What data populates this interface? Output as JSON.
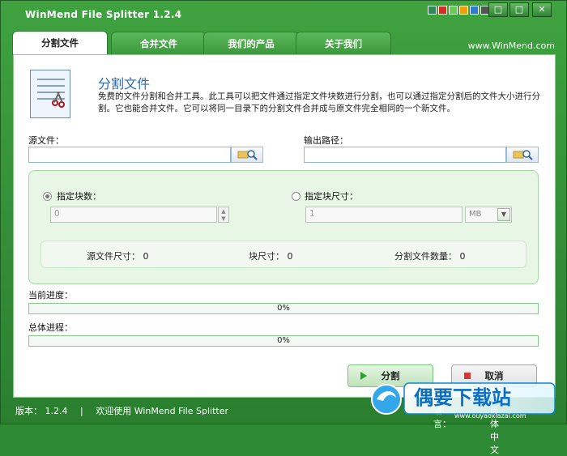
{
  "window": {
    "title": "WinMend File Splitter 1.2.4",
    "colors": {
      "green": "#2f8a35",
      "active_tab": "#ffffff",
      "accent_blue": "#2a6ab4"
    },
    "controls": {
      "minimize": "□",
      "restore": "□",
      "close": "✕"
    }
  },
  "tabs": {
    "split_file": "分割文件",
    "merge_file": "合并文件",
    "our_products": "我们的产品",
    "about_us": "关于我们"
  },
  "website": "www.WinMend.com",
  "header": {
    "title": "分割文件",
    "description": "免费的文件分割和合并工具。此工具可以把文件通过指定文件块数进行分割，也可以通过指定分割后的文件大小进行分割。它也能合并文件。它可以将同一目录下的分割文件合并成与原文件完全相同的一个新文件。"
  },
  "source_file": {
    "label": "源文件：",
    "value": ""
  },
  "output_path": {
    "label": "输出路径：",
    "value": ""
  },
  "split_options": {
    "count_label": "指定块数：",
    "count_value": "0",
    "size_label": "指定块尺寸：",
    "size_value": "1",
    "size_unit": "MB"
  },
  "info": {
    "source_size": "源文件尺寸： 0",
    "block_size": "块尺寸： 0",
    "split_count": "分割文件数量： 0"
  },
  "progress": {
    "current_label": "当前进度：",
    "current_value": "0%",
    "total_label": "总体进程：",
    "total_value": "0%"
  },
  "buttons": {
    "split": "分割",
    "cancel": "取消"
  },
  "status": {
    "version": "版本：  1.2.4",
    "welcome": "欢迎使用 WinMend File Splitter",
    "language_label": "语言：",
    "language_value": "简体中文"
  },
  "watermark": {
    "text": "偶要下载站",
    "url": "www.ouyaoxiazai.com"
  }
}
